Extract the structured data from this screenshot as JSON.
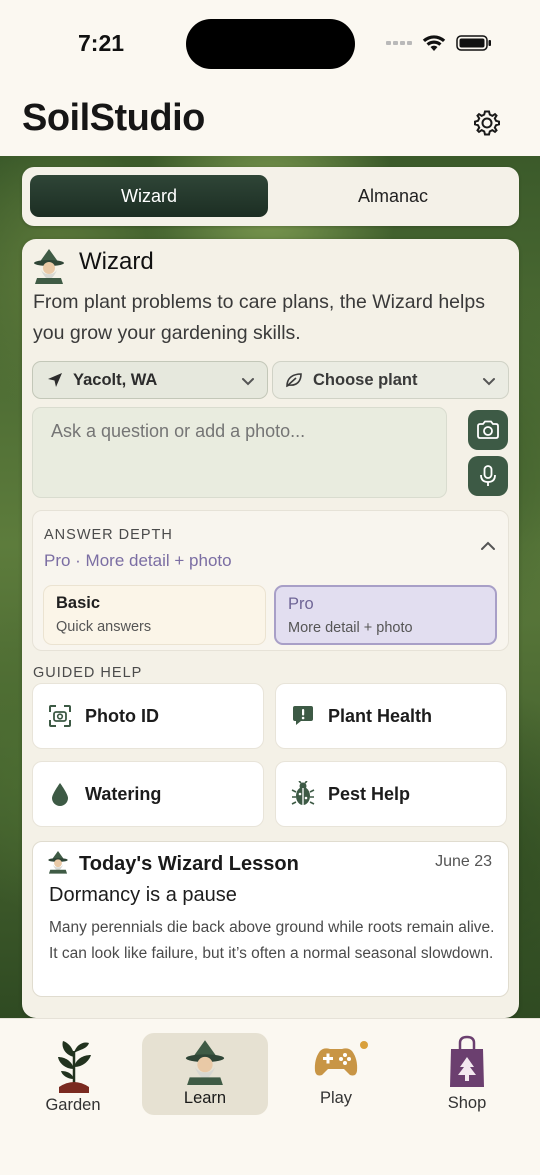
{
  "status_bar": {
    "time": "7:21"
  },
  "app": {
    "title": "SoilStudio"
  },
  "segments": {
    "wizard": "Wizard",
    "almanac": "Almanac"
  },
  "wizard": {
    "title": "Wizard",
    "description": "From plant problems to care plans, the Wizard helps you grow your gardening skills.",
    "location": "Yacolt, WA",
    "plant_select": "Choose plant",
    "ask_placeholder": "Ask a question or add a photo..."
  },
  "answer_depth": {
    "label": "ANSWER DEPTH",
    "current": "Pro · More detail + photo",
    "options": [
      {
        "name": "Basic",
        "desc": "Quick answers",
        "selected": false
      },
      {
        "name": "Pro",
        "desc": "More detail + photo",
        "selected": true
      }
    ]
  },
  "guided_help": {
    "label": "GUIDED HELP",
    "items": [
      {
        "label": "Photo ID",
        "icon": "photo-id-icon"
      },
      {
        "label": "Plant Health",
        "icon": "alert-bubble-icon"
      },
      {
        "label": "Watering",
        "icon": "water-drop-icon"
      },
      {
        "label": "Pest Help",
        "icon": "bug-icon"
      }
    ]
  },
  "lesson": {
    "title": "Today's Wizard Lesson",
    "date": "June 23",
    "headline": "Dormancy is a pause",
    "body": "Many perennials die back above ground while roots remain alive. It can look like failure, but it’s often a normal seasonal slowdown."
  },
  "tabs": [
    {
      "label": "Garden",
      "icon": "sprout-icon",
      "active": false
    },
    {
      "label": "Learn",
      "icon": "wizard-icon",
      "active": true
    },
    {
      "label": "Play",
      "icon": "gamepad-icon",
      "active": false
    },
    {
      "label": "Shop",
      "icon": "shopping-bag-icon",
      "active": false
    }
  ],
  "colors": {
    "accent_dark_green": "#1c2e23",
    "button_green": "#3d5a45",
    "pro_purple": "#7b6ea3",
    "background": "#fbf8f1"
  }
}
